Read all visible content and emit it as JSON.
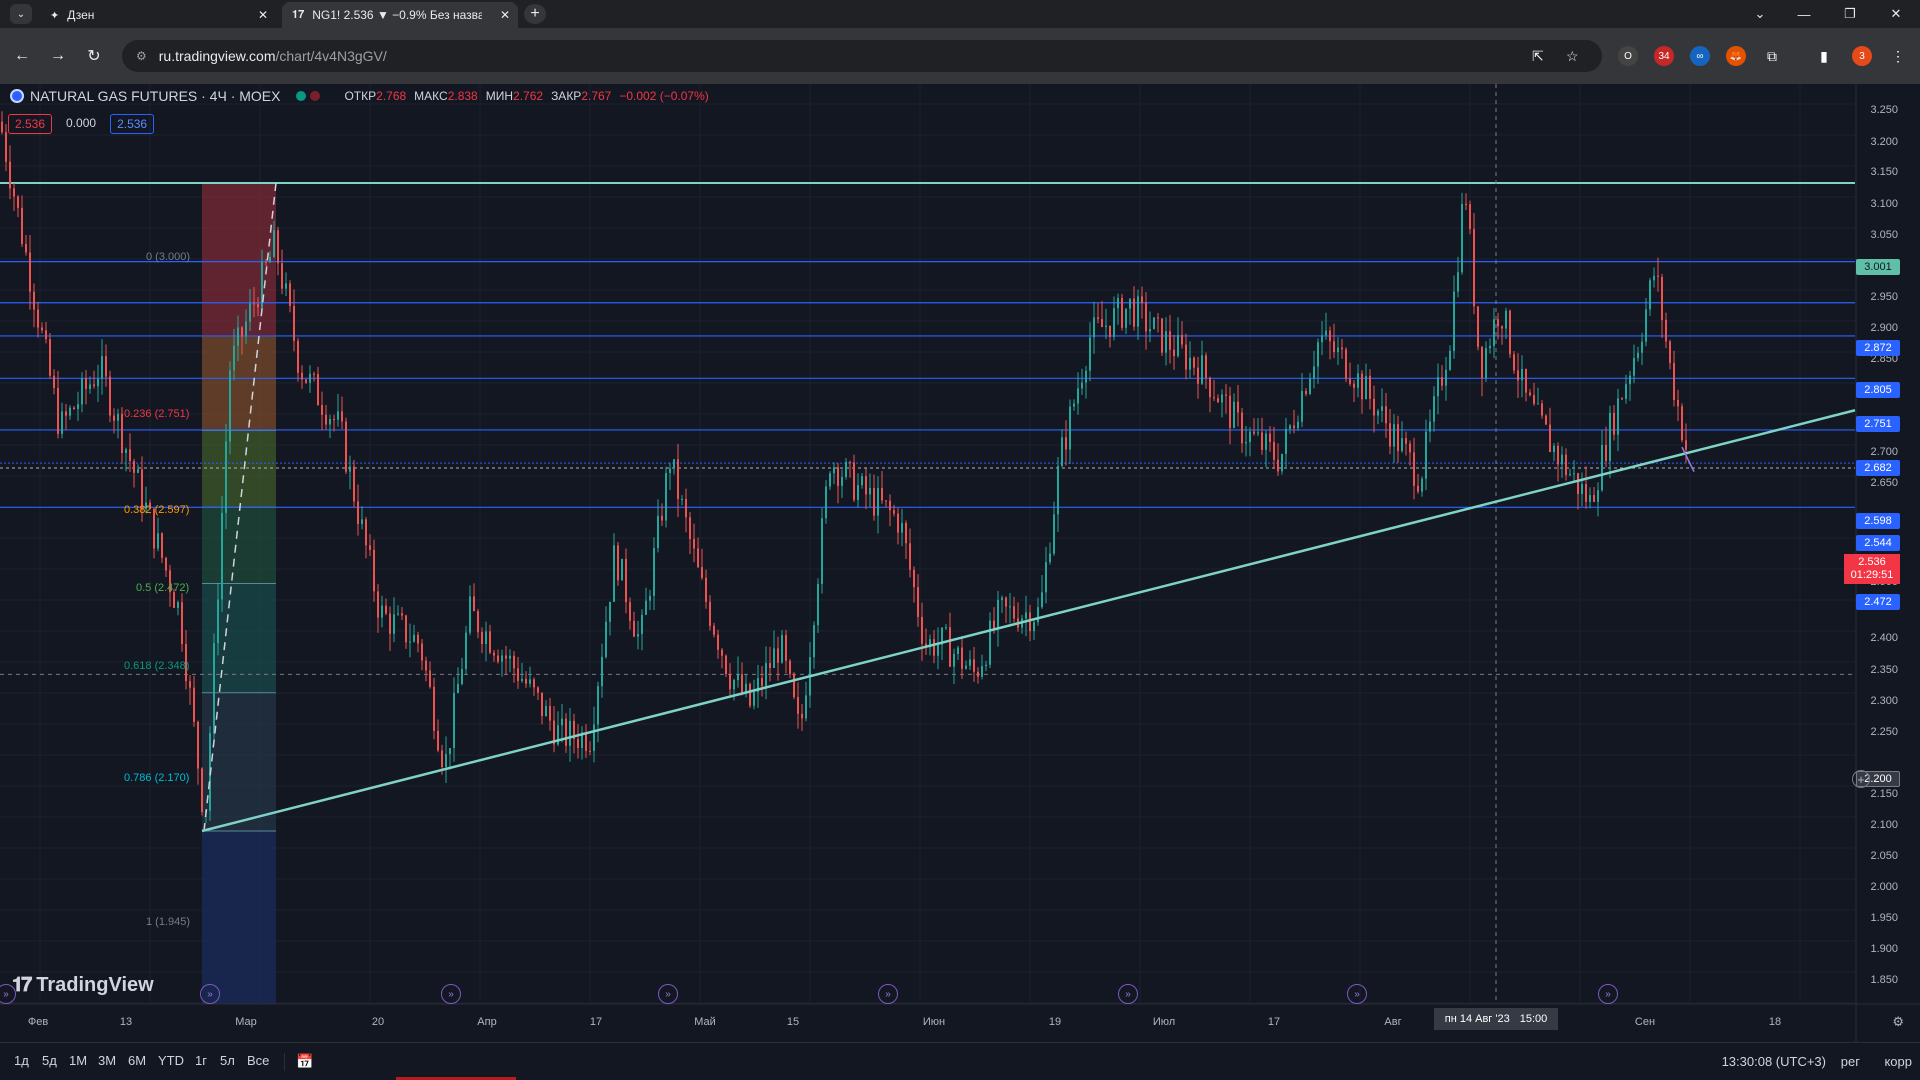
{
  "browser": {
    "tabs": [
      {
        "label": "Дзен",
        "icon": "sparkle-icon",
        "active": false
      },
      {
        "label": "NG1! 2.536 ▼ −0.9% Без назва",
        "icon": "tradingview-icon",
        "active": true
      }
    ],
    "url_host": "ru.tradingview.com",
    "url_path": "/chart/4v4N3gGV/",
    "extension_badge": "34",
    "profile_badge": "3"
  },
  "legend": {
    "symbol": "NATURAL GAS FUTURES · 4Ч · MOEX",
    "open_label": "ОТКР",
    "open": "2.768",
    "high_label": "МАКС",
    "high": "2.838",
    "low_label": "МИН",
    "low": "2.762",
    "close_label": "ЗАКР",
    "close": "2.767",
    "change": "−0.002 (−0.07%)"
  },
  "pricebox": {
    "sell": "2.536",
    "spread": "0.000",
    "buy": "2.536"
  },
  "fib_labels": [
    {
      "text": "0 (3.000)",
      "color": "#787b86"
    },
    {
      "text": "0.236 (2.751)",
      "color": "#f23645"
    },
    {
      "text": "0.382 (2.597)",
      "color": "#ff9800"
    },
    {
      "text": "0.5 (2.472)",
      "color": "#4caf50"
    },
    {
      "text": "0.618 (2.348)",
      "color": "#089981"
    },
    {
      "text": "0.786 (2.170)",
      "color": "#00bcd4"
    },
    {
      "text": "1 (1.945)",
      "color": "#787b86"
    }
  ],
  "yaxis": {
    "ticks": [
      "3.250",
      "3.200",
      "3.150",
      "3.100",
      "3.050",
      "2.950",
      "2.900",
      "2.850",
      "2.700",
      "2.650",
      "2.450",
      "2.400",
      "2.350",
      "2.300",
      "2.250",
      "2.150",
      "2.100",
      "2.050",
      "2.000",
      "1.950",
      "1.900",
      "1.850",
      "2.500"
    ],
    "badges": [
      {
        "text": "3.001",
        "color": "#5fbfa8"
      },
      {
        "text": "2.872",
        "color": "#2962ff"
      },
      {
        "text": "2.805",
        "color": "#2962ff"
      },
      {
        "text": "2.751",
        "color": "#2962ff"
      },
      {
        "text": "2.682",
        "color": "#2962ff"
      },
      {
        "text": "2.598",
        "color": "#2962ff"
      },
      {
        "text": "2.544",
        "color": "#2962ff"
      },
      {
        "text": "2.472",
        "color": "#2962ff"
      },
      {
        "text": "2.200",
        "color": "#363a45"
      }
    ],
    "last_price": "2.536",
    "countdown": "01:29:51"
  },
  "xaxis": {
    "labels": [
      "Фев",
      "13",
      "Мар",
      "20",
      "Апр",
      "17",
      "Май",
      "15",
      "Июн",
      "19",
      "Июл",
      "17",
      "Авг",
      "Сен",
      "18"
    ],
    "crosshair_date": "пн 14 Авг '23",
    "crosshair_time": "15:00"
  },
  "logo": "TradingView",
  "bottom": {
    "ranges": [
      "1д",
      "5д",
      "1М",
      "3М",
      "6М",
      "YTD",
      "1г",
      "5л",
      "Все"
    ],
    "clock": "13:30:08 (UTC+3)",
    "mode_reg": "рег",
    "mode_corr": "корр"
  },
  "colors": {
    "bg": "#131722",
    "support_line": "#7fd3c6",
    "level_line": "#2962ff",
    "up": "#26a69a",
    "down": "#ef5350"
  }
}
